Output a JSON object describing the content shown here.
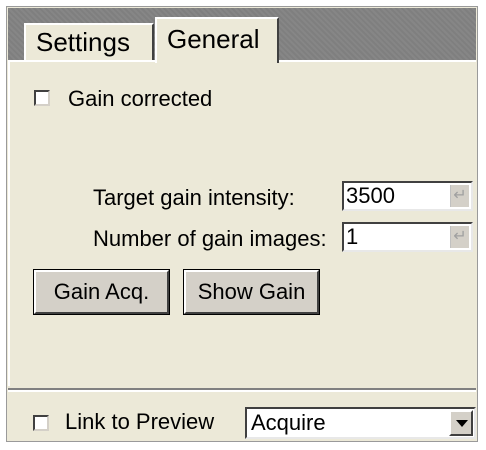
{
  "tabs": [
    {
      "label": "Settings",
      "active": false
    },
    {
      "label": "General",
      "active": true
    }
  ],
  "gain_corrected": {
    "label": "Gain corrected",
    "checked": false
  },
  "target_gain_intensity": {
    "label": "Target gain intensity:",
    "value": "3500"
  },
  "number_of_gain_images": {
    "label": "Number of gain images:",
    "value": "1"
  },
  "buttons": {
    "gain_acq": "Gain Acq.",
    "show_gain": "Show Gain"
  },
  "link_to_preview": {
    "label": "Link to Preview",
    "checked": false
  },
  "mode_select": {
    "value": "Acquire"
  },
  "icons": {
    "enter": "enter-icon",
    "dropdown": "chevron-down-icon"
  }
}
